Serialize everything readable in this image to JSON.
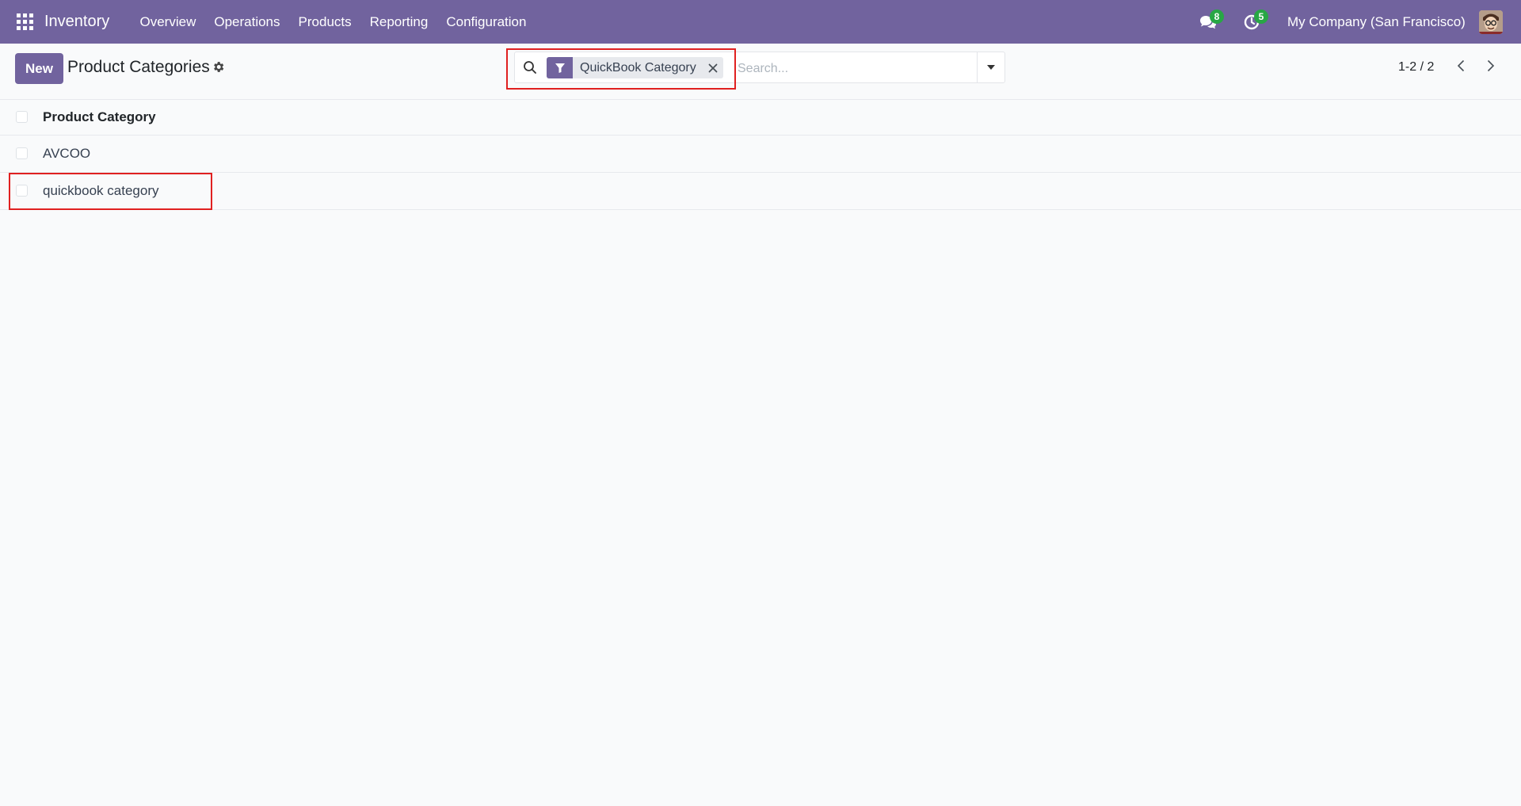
{
  "navbar": {
    "brand": "Inventory",
    "menu": [
      "Overview",
      "Operations",
      "Products",
      "Reporting",
      "Configuration"
    ],
    "messages_count": "8",
    "activities_count": "5",
    "company": "My Company (San Francisco)"
  },
  "control_panel": {
    "new_label": "New",
    "title": "Product Categories",
    "search": {
      "facet_value": "QuickBook Category",
      "placeholder": "Search..."
    },
    "pager": "1-2 / 2"
  },
  "list": {
    "column_header": "Product Category",
    "rows": [
      "AVCOO",
      "quickbook category"
    ]
  },
  "colors": {
    "brand": "#71639e",
    "badge": "#28a745",
    "highlight": "#e02020"
  },
  "icons": [
    "apps-grid-icon",
    "chat-icon",
    "activity-clock-icon",
    "gear-icon",
    "search-icon",
    "filter-icon",
    "close-icon",
    "caret-down-icon",
    "chevron-left-icon",
    "chevron-right-icon"
  ]
}
